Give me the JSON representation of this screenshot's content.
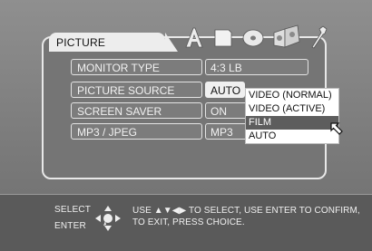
{
  "menu": {
    "tab_title": "PICTURE",
    "tab_icons": [
      "language-icon",
      "page-icon",
      "disc-icon",
      "speaker-icon",
      "wrench-icon"
    ],
    "rows": [
      {
        "label": "MONITOR TYPE",
        "value": "4:3 LB"
      },
      {
        "label": "PICTURE SOURCE",
        "value": "AUTO"
      },
      {
        "label": "SCREEN SAVER",
        "value": "ON"
      },
      {
        "label": "MP3 / JPEG",
        "value": "MP3"
      }
    ],
    "dropdown": {
      "options": [
        "VIDEO (NORMAL)",
        "VIDEO (ACTIVE)",
        "FILM",
        "AUTO"
      ],
      "highlighted": "FILM"
    }
  },
  "help": {
    "select_key": "SELECT",
    "enter_key": "ENTER",
    "line1": "USE ▲▼◀▶ TO SELECT,  USE ENTER TO CONFIRM,",
    "line2": "TO EXIT, PRESS CHOICE."
  },
  "colors": {
    "background": "#7a7a7a",
    "panel_border": "#e8e8e8",
    "highlight": "#5d5d5d",
    "help_bar": "#5a5a5a"
  }
}
